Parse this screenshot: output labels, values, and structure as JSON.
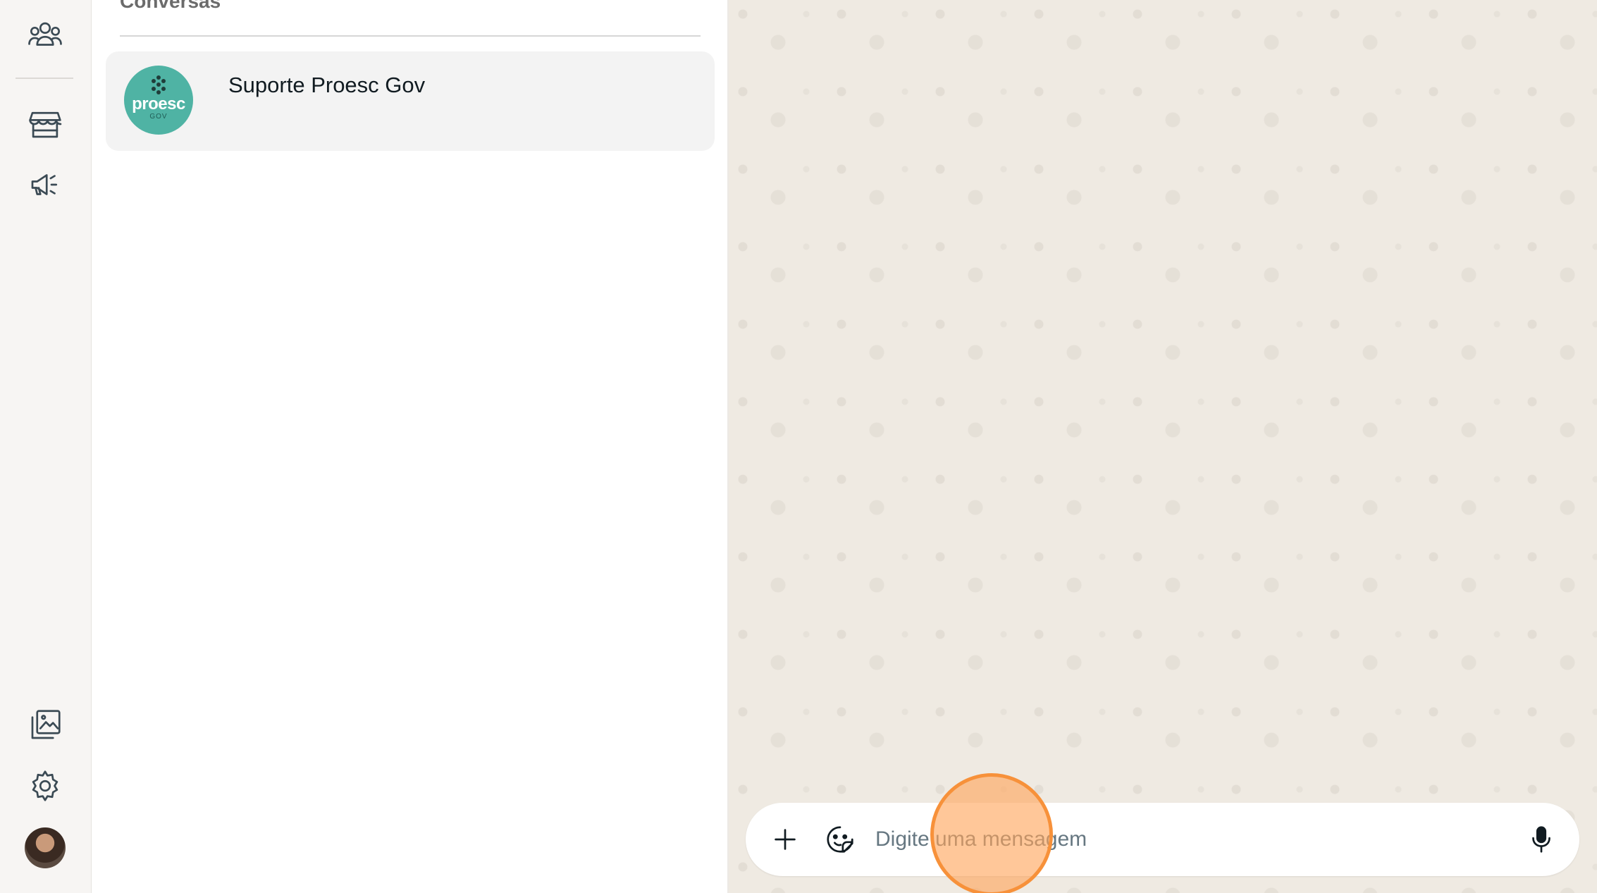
{
  "rail": {
    "top_items": [
      {
        "name": "communities-icon"
      },
      {
        "name": "business-tools-icon"
      },
      {
        "name": "announcements-icon"
      }
    ],
    "bottom_items": [
      {
        "name": "media-icon"
      },
      {
        "name": "settings-icon"
      }
    ]
  },
  "list": {
    "heading": "Conversas",
    "chats": [
      {
        "name": "Suporte Proesc Gov",
        "avatar_text": "proesc",
        "avatar_sub": "GOV"
      }
    ]
  },
  "composer": {
    "placeholder": "Digite uma mensagem"
  },
  "colors": {
    "accent": "#4fb3a4",
    "chat_background": "#efeae2",
    "click_marker": "#f7913a"
  }
}
